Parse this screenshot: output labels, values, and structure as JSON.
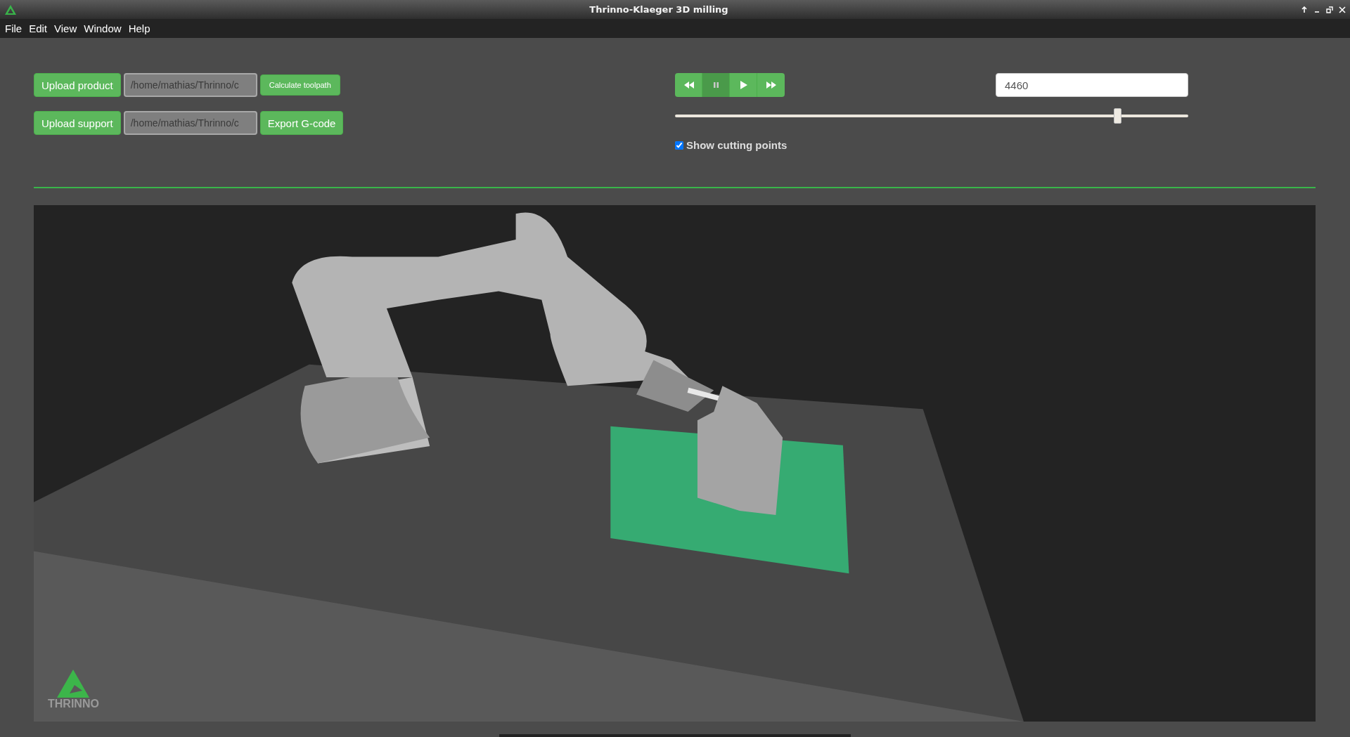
{
  "window": {
    "title": "Thrinno-Klaeger 3D milling"
  },
  "menu": [
    "File",
    "Edit",
    "View",
    "Window",
    "Help"
  ],
  "file_rows": [
    {
      "button": "Upload product",
      "path": "/home/mathias/Thrinno/c",
      "action": "Calculate toolpath",
      "kind": "small"
    },
    {
      "button": "Upload support",
      "path": "/home/mathias/Thrinno/c",
      "action": "Export G-code",
      "kind": "normal"
    }
  ],
  "playback": [
    {
      "kind": "rewind",
      "selected": false
    },
    {
      "kind": "pause",
      "selected": true
    },
    {
      "kind": "play",
      "selected": false
    },
    {
      "kind": "forward",
      "selected": false
    }
  ],
  "frame": {
    "value": "4460"
  },
  "timeline": {
    "level": 0.862
  },
  "show_cutting_points": {
    "label": "Show cutting points",
    "checked": true
  },
  "logo": {
    "text": "THRINNO"
  }
}
